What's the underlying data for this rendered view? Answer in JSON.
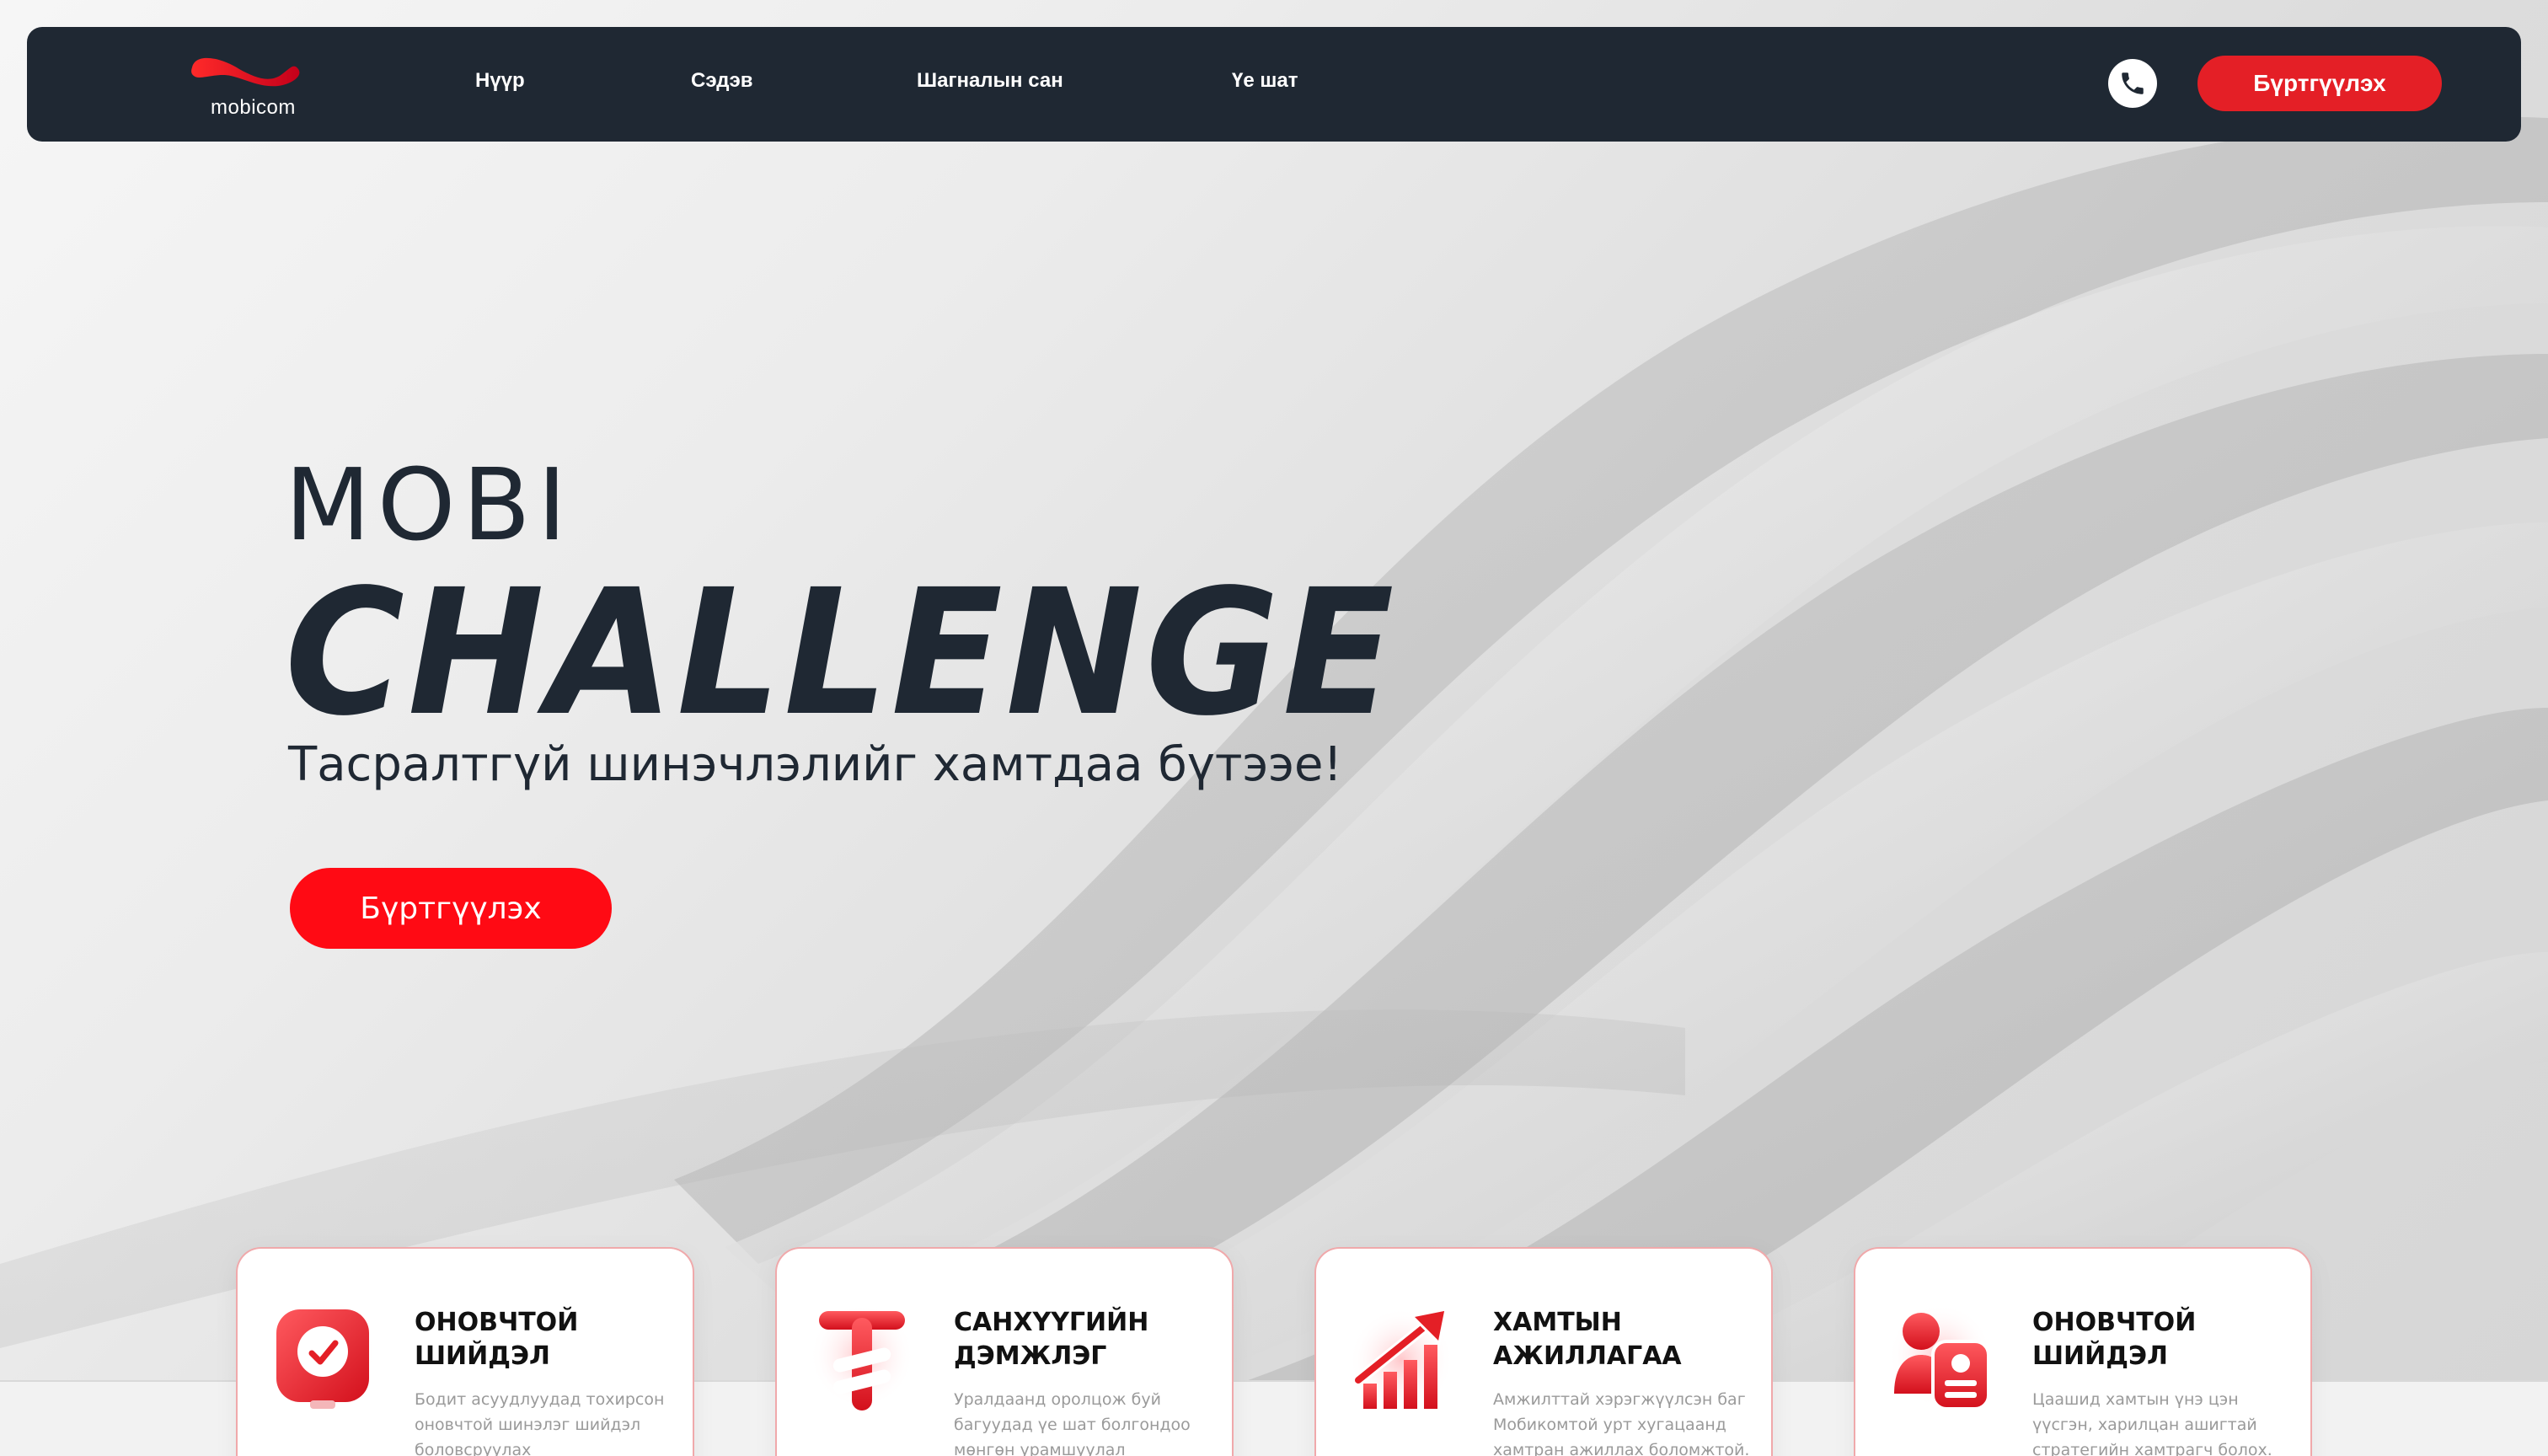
{
  "brand": {
    "logo_text": "mobicom",
    "accent_color": "#e41f26",
    "navbar_color": "#1f2833"
  },
  "nav": {
    "items": [
      {
        "label": "Нүүр"
      },
      {
        "label": "Сэдэв"
      },
      {
        "label": "Шагналын сан"
      },
      {
        "label": "Үе шат"
      }
    ],
    "phone_icon": "phone-icon",
    "register_label": "Бүртгүүлэх"
  },
  "hero": {
    "title_line1": "MOBI",
    "title_line2": "CHALLENGE",
    "tagline": "Тасралтгүй шинэчлэлийг хамтдаа бүтээе!",
    "register_label": "Бүртгүүлэх"
  },
  "cards": [
    {
      "icon": "solution-bulb-icon",
      "title_line1": "ОНОВЧТОЙ",
      "title_line2": "ШИЙДЭЛ",
      "desc_line1": "Бодит асуудлуудад тохирсон",
      "desc_line2": "оновчтой шинэлэг шийдэл",
      "desc_line3": "боловсруулах"
    },
    {
      "icon": "tugrik-icon",
      "title_line1": "САНХҮҮГИЙН",
      "title_line2": "ДЭМЖЛЭГ",
      "desc_line1": "Уралдаанд оролцож буй",
      "desc_line2": "багуудад үе шат болгондоо",
      "desc_line3": "мөнгөн урамшуулал"
    },
    {
      "icon": "growth-chart-icon",
      "title_line1": "ХАМТЫН",
      "title_line2": "АЖИЛЛАГАА",
      "desc_line1": "Амжилттай хэрэгжүүлсэн баг",
      "desc_line2": "Мобикомтой урт хугацаанд",
      "desc_line3": "хамтран ажиллах боломжтой."
    },
    {
      "icon": "person-card-icon",
      "title_line1": "ОНОВЧТОЙ",
      "title_line2": "ШИЙДЭЛ",
      "desc_line1": "Цаашид хамтын үнэ цэн",
      "desc_line2": "үүсгэн, харилцан ашигтай",
      "desc_line3": "стратегийн хамтрагч болох."
    }
  ]
}
